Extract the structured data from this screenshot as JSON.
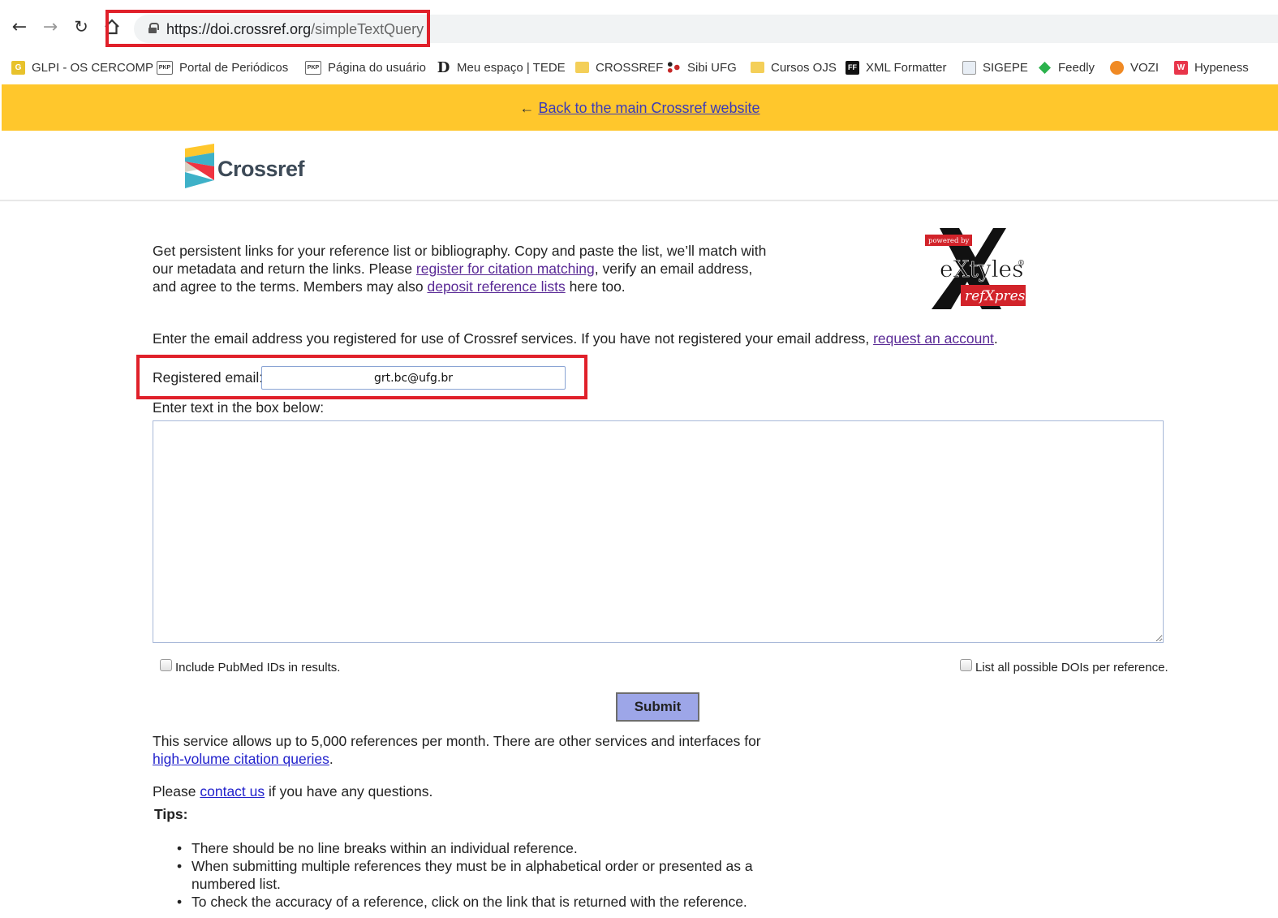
{
  "browser": {
    "url_host": "https://doi.crossref.org",
    "url_path": "/simpleTextQuery",
    "bookmarks": [
      {
        "label": "GLPI - OS CERCOMP",
        "icon": "glpi-icon"
      },
      {
        "label": "Portal de Periódicos",
        "icon": "pkp-icon"
      },
      {
        "label": "Página do usuário",
        "icon": "pkp-icon"
      },
      {
        "label": "Meu espaço | TEDE",
        "icon": "dspace-icon"
      },
      {
        "label": "CROSSREF",
        "icon": "folder-icon"
      },
      {
        "label": "Sibi UFG",
        "icon": "sibi-icon"
      },
      {
        "label": "Cursos OJS",
        "icon": "folder-icon"
      },
      {
        "label": "XML Formatter",
        "icon": "ff-icon"
      },
      {
        "label": "SIGEPE",
        "icon": "sigepe-icon"
      },
      {
        "label": "Feedly",
        "icon": "feedly-icon"
      },
      {
        "label": "VOZI",
        "icon": "vozi-icon"
      },
      {
        "label": "Hypeness",
        "icon": "hypeness-icon"
      }
    ]
  },
  "banner": {
    "arrow": "←",
    "link": "Back to the main Crossref website"
  },
  "header": {
    "logo_text": "Crossref"
  },
  "badge": {
    "powered_by": "powered by",
    "name": "eXtyles",
    "sub": "refXpress",
    "reg": "®"
  },
  "intro": {
    "part1": "Get persistent links for your reference list or bibliography. Copy and paste the list, we’ll match with our metadata and return the links. Please ",
    "link1": "register for citation matching",
    "part2": ", verify an email address, and agree to the terms. Members may also ",
    "link2": "deposit reference lists",
    "part3": " here too."
  },
  "instruction": {
    "text": "Enter the email address you registered for use of Crossref services. If you have not registered your email address, ",
    "link": "request an account",
    "end": "."
  },
  "form": {
    "email_label": "Registered email:",
    "email_value": "grt.bc@ufg.br",
    "box_label": "Enter text in the box below:",
    "pubmed_label": "Include PubMed IDs in results.",
    "all_dois_label": "List all possible DOIs per reference.",
    "submit_label": "Submit"
  },
  "service": {
    "text": "This service allows up to 5,000 references per month. There are other services and interfaces for ",
    "link": "high-volume citation queries",
    "end": "."
  },
  "contact": {
    "pre": "Please ",
    "link": "contact us",
    "post": " if you have any questions."
  },
  "tips": {
    "title": "Tips:",
    "items": [
      "There should be no line breaks within an individual reference.",
      "When submitting multiple references they must be in alphabetical order or presented as a numbered list.",
      "To check the accuracy of a reference, click on the link that is returned with the reference."
    ]
  }
}
